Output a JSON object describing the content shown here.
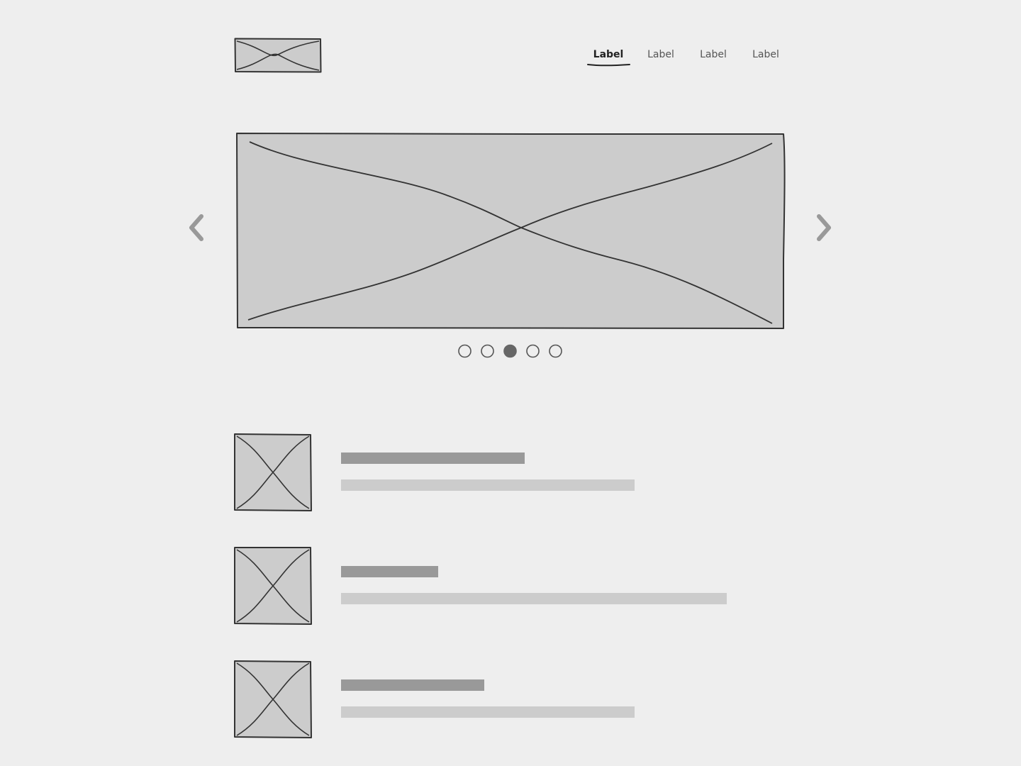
{
  "colors": {
    "background": "#eeeeee",
    "placeholder_fill": "#cccccc",
    "stroke": "#333333",
    "title_bar": "#999999",
    "desc_bar": "#cccccc",
    "arrow": "#999999",
    "active_dot": "#666666"
  },
  "header": {
    "logo_icon": "image-placeholder-icon",
    "nav": [
      {
        "label": "Label",
        "active": true
      },
      {
        "label": "Label",
        "active": false
      },
      {
        "label": "Label",
        "active": false
      },
      {
        "label": "Label",
        "active": false
      }
    ]
  },
  "carousel": {
    "image_icon": "image-placeholder-icon",
    "prev_icon": "chevron-left-icon",
    "next_icon": "chevron-right-icon",
    "slide_count": 5,
    "active_slide": 3
  },
  "list": {
    "items": [
      {
        "thumb_icon": "image-placeholder-icon",
        "title_fraction": 0.36,
        "desc_fraction": 0.575
      },
      {
        "thumb_icon": "image-placeholder-icon",
        "title_fraction": 0.19,
        "desc_fraction": 0.755
      },
      {
        "thumb_icon": "image-placeholder-icon",
        "title_fraction": 0.28,
        "desc_fraction": 0.575
      }
    ]
  }
}
